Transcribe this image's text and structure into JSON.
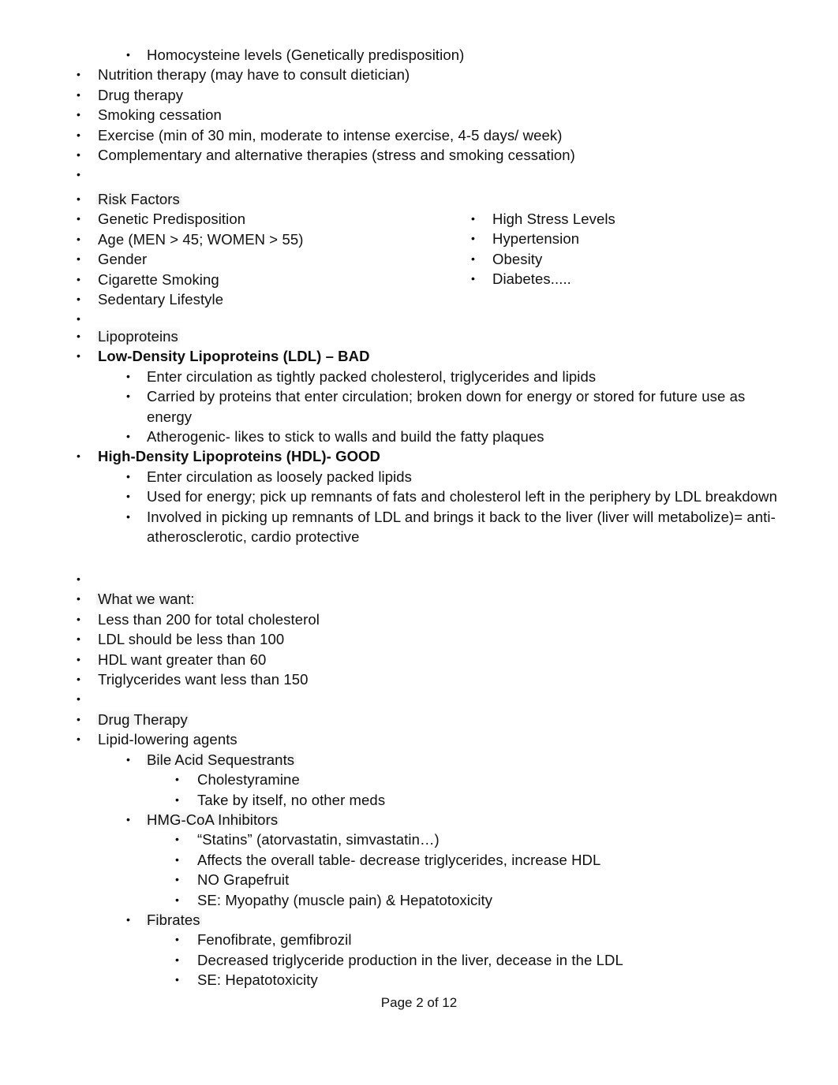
{
  "document": {
    "footer": "Page 2 of 12"
  },
  "top_section": {
    "items": [
      {
        "level": 2,
        "text": "Homocysteine levels (Genetically predisposition)"
      },
      {
        "level": 1,
        "text": "Nutrition therapy (may have to consult dietician)"
      },
      {
        "level": 1,
        "text": "Drug therapy"
      },
      {
        "level": 1,
        "text": "Smoking cessation"
      },
      {
        "level": 1,
        "text": "Exercise (min of 30 min, moderate to intense exercise, 4-5 days/ week)"
      },
      {
        "level": 1,
        "text": "Complementary and alternative therapies (stress and smoking cessation)"
      },
      {
        "level": 1,
        "text": ""
      }
    ]
  },
  "risk_factors": {
    "left_column": [
      "Risk Factors",
      "Genetic Predisposition",
      "Age (MEN > 45; WOMEN > 55)",
      "Gender",
      "Cigarette Smoking",
      "Sedentary Lifestyle"
    ],
    "right_column": [
      "High Stress Levels",
      "Hypertension",
      "Obesity",
      "Diabetes....."
    ]
  },
  "lipoproteins": {
    "heading": "Lipoproteins",
    "ldl": {
      "heading": "Low-Density Lipoproteins (LDL) – BAD",
      "points": [
        "Enter circulation as tightly packed cholesterol, triglycerides and lipids",
        "Carried by proteins that enter circulation; broken down for energy or stored for future use as energy",
        "Atherogenic- likes to stick to walls and build the fatty plaques"
      ]
    },
    "hdl": {
      "heading": "High-Density Lipoproteins (HDL)- GOOD",
      "points": [
        "Enter circulation as loosely packed lipids",
        "Used for energy; pick up remnants of fats and cholesterol left in the periphery by LDL breakdown",
        "Involved in picking up remnants of LDL and brings it back to the liver (liver will metabolize)= anti-atherosclerotic, cardio protective"
      ]
    }
  },
  "what_we_want": {
    "heading": "What we want:",
    "items": [
      "Less than 200 for total cholesterol",
      "LDL should be less than 100",
      "HDL want greater than 60",
      "Triglycerides want less than 150"
    ]
  },
  "drug_therapy": {
    "heading": "Drug Therapy",
    "subheading": "Lipid-lowering agents",
    "classes": [
      {
        "name": "Bile Acid Sequestrants",
        "points": [
          "Cholestyramine",
          "Take by itself, no other meds"
        ]
      },
      {
        "name": "HMG-CoA Inhibitors",
        "points": [
          "“Statins” (atorvastatin, simvastatin…)",
          "Affects the overall table- decrease triglycerides, increase HDL",
          "NO Grapefruit",
          "SE: Myopathy (muscle pain) & Hepatotoxicity"
        ]
      },
      {
        "name": "Fibrates",
        "points": [
          "Fenofibrate, gemfibrozil",
          "Decreased triglyceride production in the liver, decease in the LDL",
          "SE: Hepatotoxicity"
        ]
      }
    ]
  }
}
